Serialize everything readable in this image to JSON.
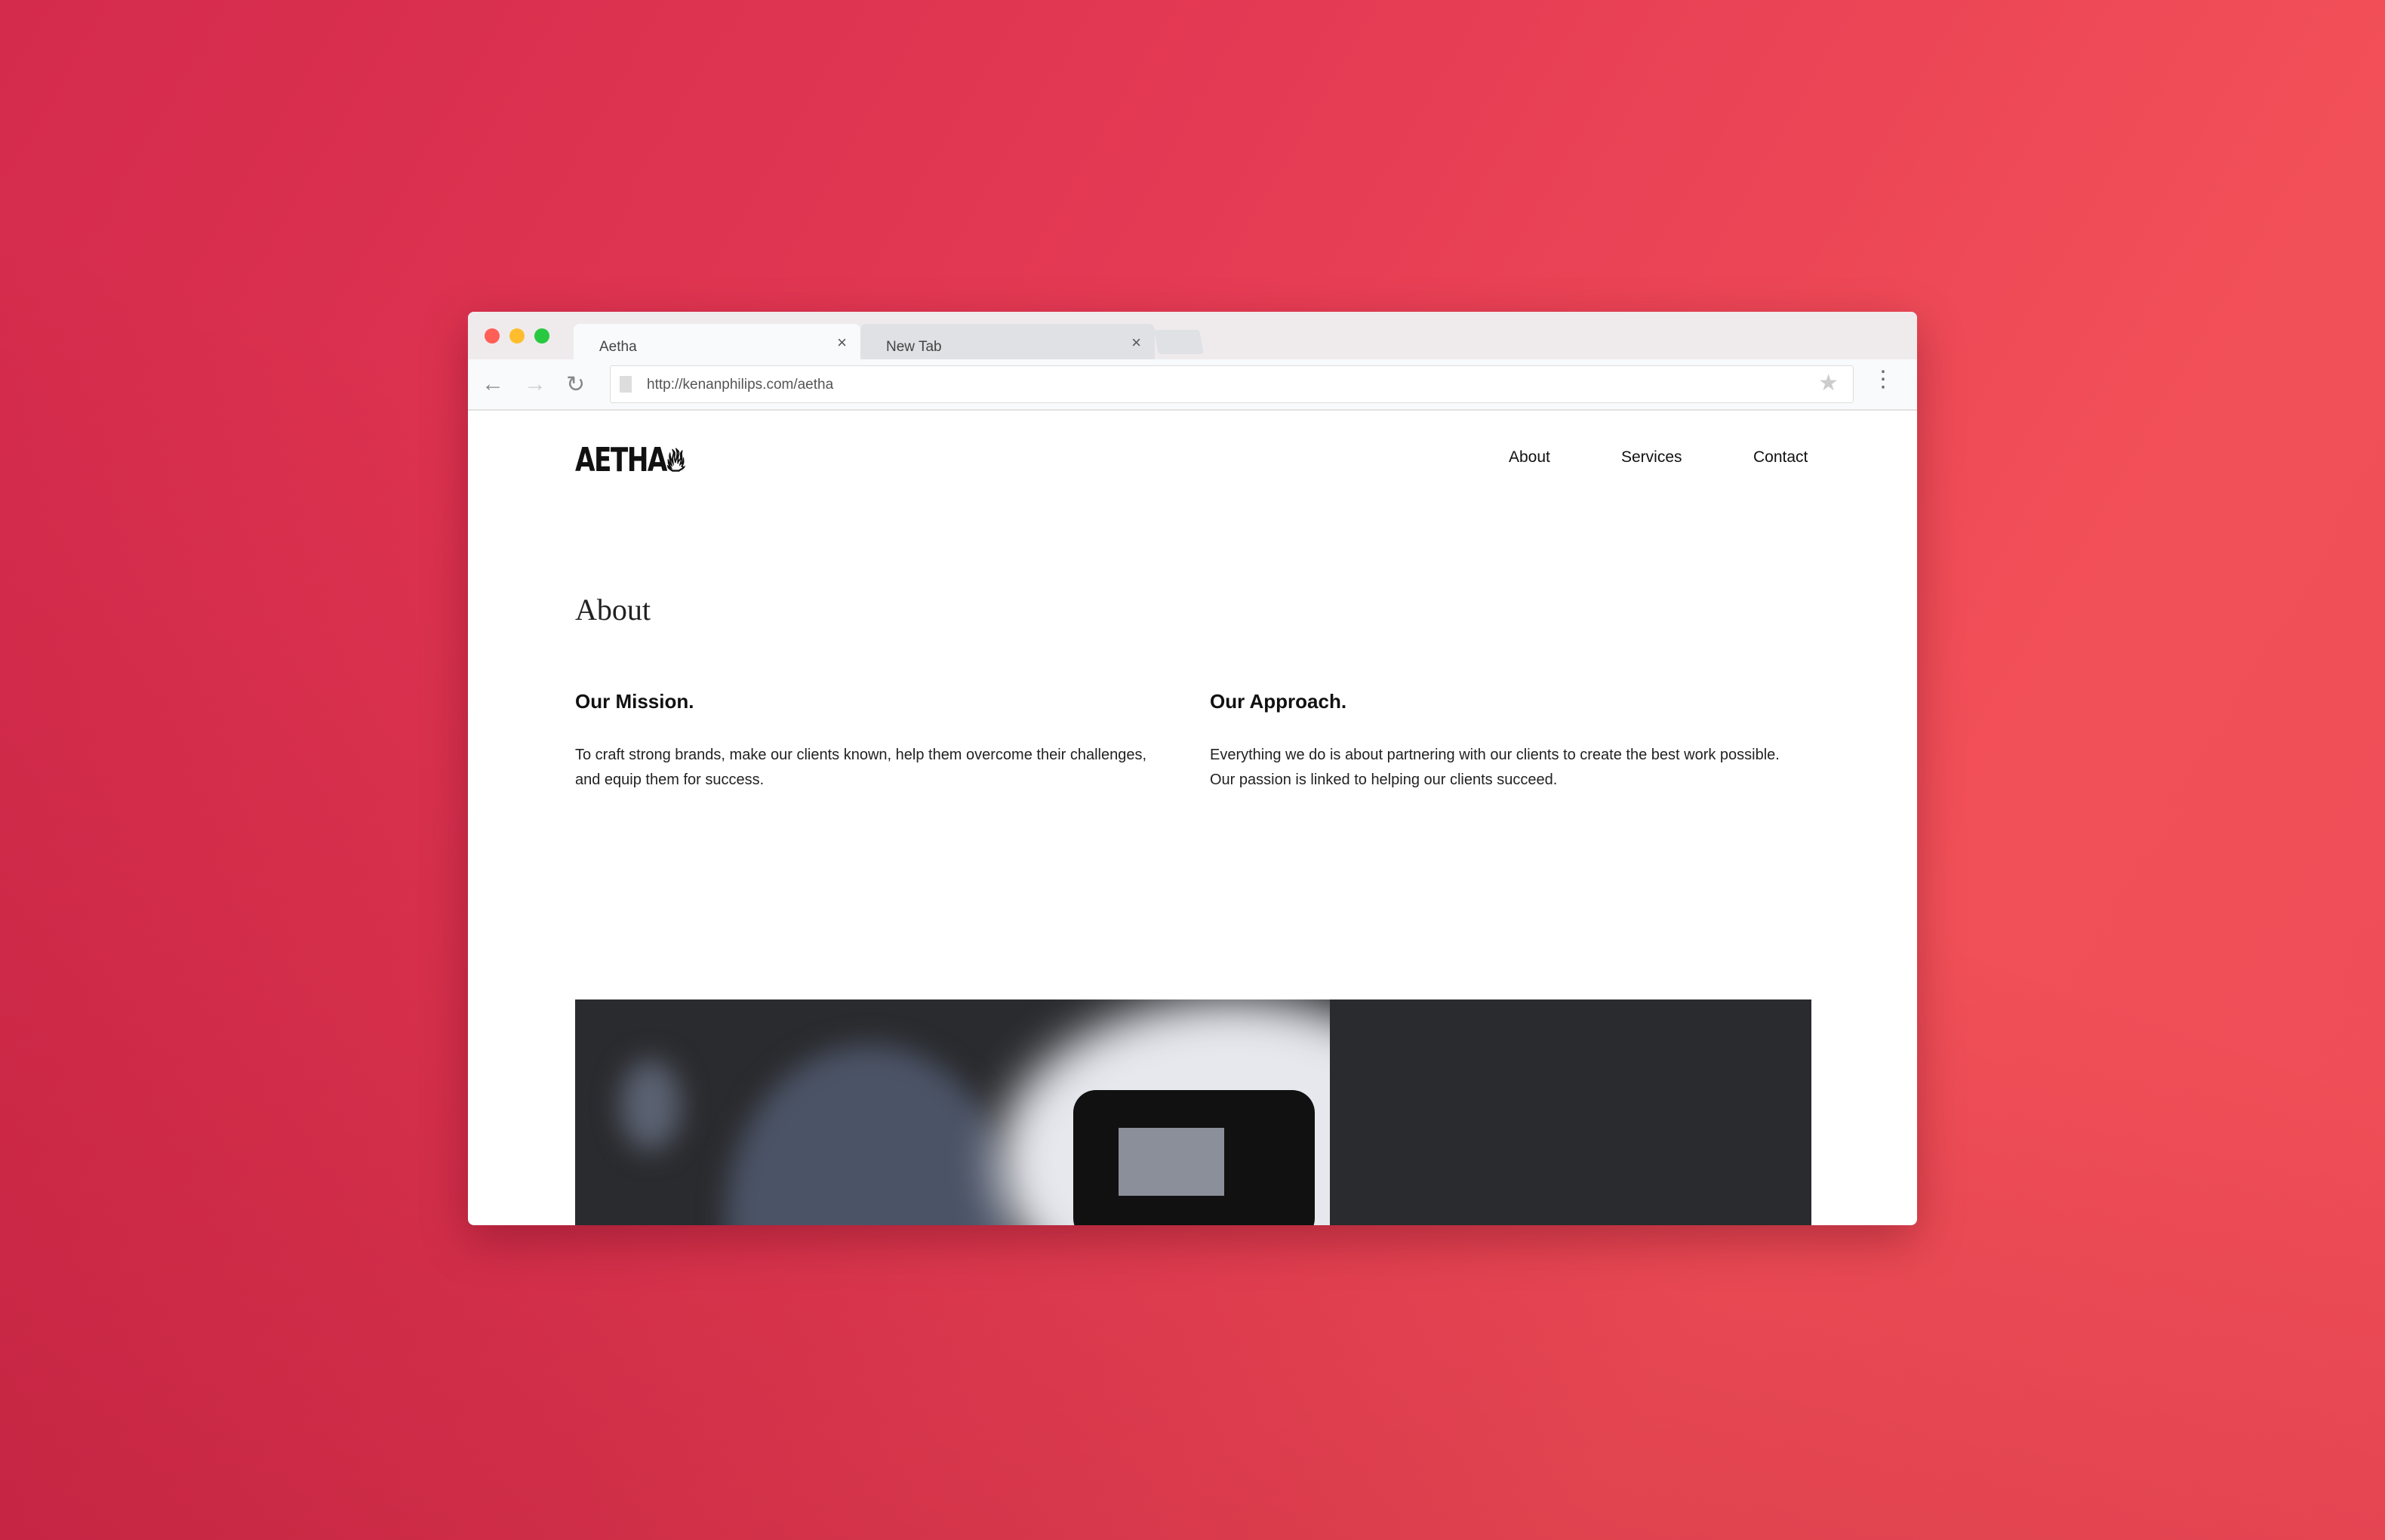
{
  "browser": {
    "tabs": [
      {
        "title": "Aetha",
        "active": true
      },
      {
        "title": "New Tab",
        "active": false
      }
    ],
    "close_glyph": "×",
    "url": "http://kenanphilips.com/aetha",
    "icons": [
      "back-icon",
      "forward-icon",
      "reload-icon",
      "page-icon",
      "star-icon",
      "menu-icon"
    ]
  },
  "site": {
    "logo": "AETHA",
    "nav": [
      "About",
      "Services",
      "Contact"
    ],
    "heading": "About",
    "columns": [
      {
        "title": "Our Mission.",
        "text": "To craft strong brands, make our clients known, help them overcome their challenges, and equip them for success."
      },
      {
        "title": "Our Approach.",
        "text": "Everything we do is about partnering with our clients to create the best work possible. Our passion is linked to helping our clients succeed."
      }
    ]
  },
  "colors": {
    "background": "#e53a54",
    "close": "#ff5f57",
    "minimize": "#ffbd2e",
    "maximize": "#28c940"
  }
}
